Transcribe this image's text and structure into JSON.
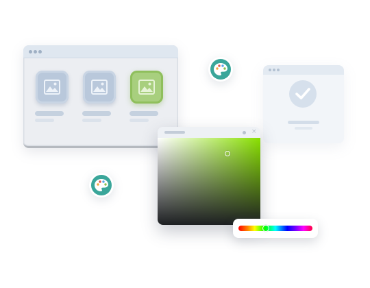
{
  "gallery": {
    "thumbnails": [
      {
        "selected": false
      },
      {
        "selected": false
      },
      {
        "selected": true
      }
    ]
  },
  "success": {
    "status": "checked"
  },
  "picker": {
    "hue_color": "#89e000",
    "saturation": 0.68,
    "brightness": 0.82,
    "hue_position": 0.37
  },
  "colors": {
    "accent_green": "#a8cf7e",
    "palette_teal": "#3aa69a",
    "window_gray": "#eceef2"
  },
  "icons": [
    "image-icon",
    "palette-icon",
    "checkmark-icon",
    "close-icon"
  ]
}
